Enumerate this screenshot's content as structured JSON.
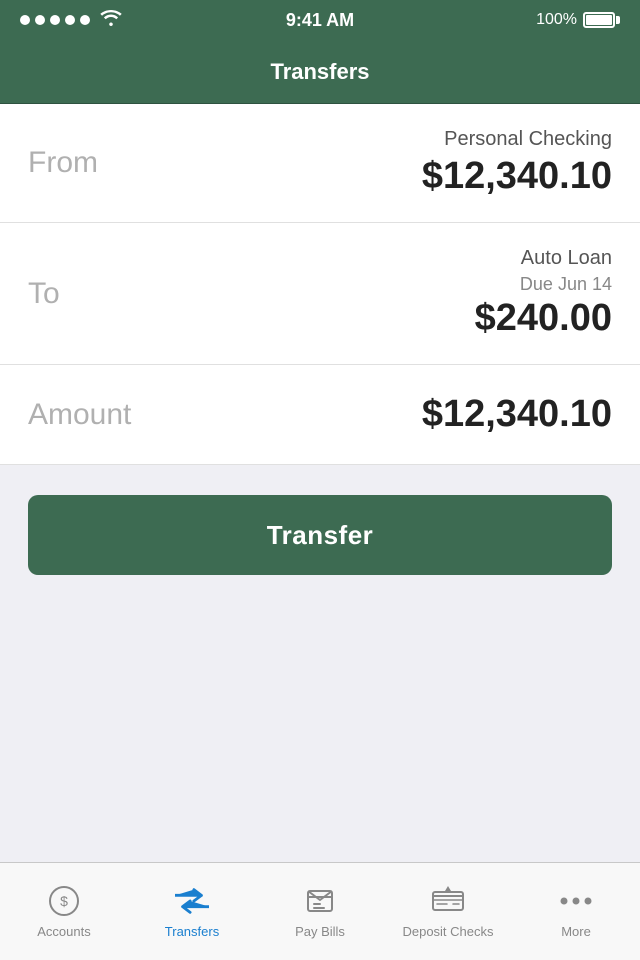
{
  "statusBar": {
    "time": "9:41 AM",
    "batteryPct": "100%"
  },
  "navBar": {
    "title": "Transfers"
  },
  "fromRow": {
    "label": "From",
    "accountName": "Personal Checking",
    "amount": "$12,340.10"
  },
  "toRow": {
    "label": "To",
    "accountName": "Auto Loan",
    "due": "Due Jun 14",
    "amount": "$240.00"
  },
  "amountRow": {
    "label": "Amount",
    "amount": "$12,340.10"
  },
  "transferButton": {
    "label": "Transfer"
  },
  "tabBar": {
    "items": [
      {
        "id": "accounts",
        "label": "Accounts",
        "active": false
      },
      {
        "id": "transfers",
        "label": "Transfers",
        "active": true
      },
      {
        "id": "pay-bills",
        "label": "Pay Bills",
        "active": false
      },
      {
        "id": "deposit-checks",
        "label": "Deposit Checks",
        "active": false
      },
      {
        "id": "more",
        "label": "More",
        "active": false
      }
    ]
  }
}
